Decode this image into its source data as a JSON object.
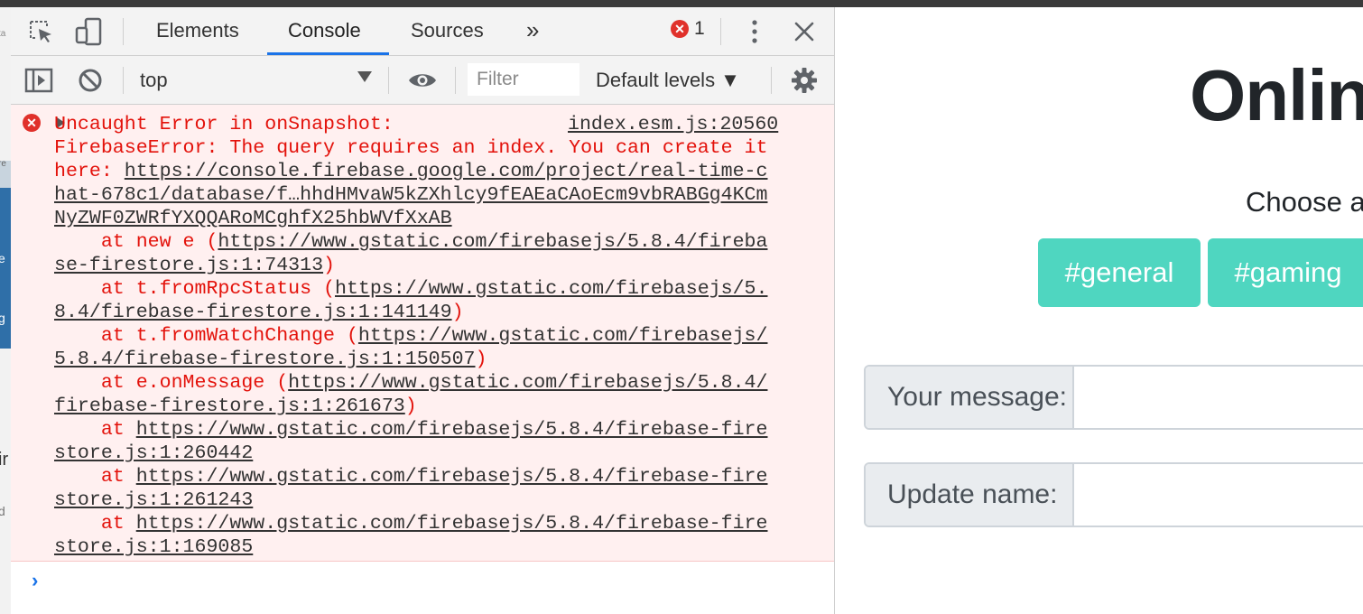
{
  "devtools": {
    "tabs": {
      "elements": "Elements",
      "console": "Console",
      "sources": "Sources",
      "more": "»"
    },
    "error_count": "1",
    "toolbar": {
      "context": "top",
      "filter_placeholder": "Filter",
      "levels": "Default levels ▼"
    },
    "console_error": {
      "source": "index.esm.js:20560",
      "lines": [
        {
          "t": "Uncaught Error in onSnapshot:"
        },
        {
          "t": "FirebaseError: The query requires an index. You can create it"
        },
        {
          "t": "here: ",
          "link": "https://console.firebase.google.com/project/real-time-c"
        },
        {
          "link": "hat-678c1/database/f…hhdHMvaW5kZXhlcy9fEAEaCAoEcm9vbRABGg4KCm"
        },
        {
          "link": "NyZWF0ZWRfYXQQARoMCghfX25hbWVfXxAB"
        },
        {
          "t": "    at new e (",
          "link": "https://www.gstatic.com/firebasejs/5.8.4/fireba"
        },
        {
          "link": "se-firestore.js:1:74313",
          "after": ")"
        },
        {
          "t": "    at t.fromRpcStatus (",
          "link": "https://www.gstatic.com/firebasejs/5."
        },
        {
          "link": "8.4/firebase-firestore.js:1:141149",
          "after": ")"
        },
        {
          "t": "    at t.fromWatchChange (",
          "link": "https://www.gstatic.com/firebasejs/"
        },
        {
          "link": "5.8.4/firebase-firestore.js:1:150507",
          "after": ")"
        },
        {
          "t": "    at e.onMessage (",
          "link": "https://www.gstatic.com/firebasejs/5.8.4/"
        },
        {
          "link": "firebase-firestore.js:1:261673",
          "after": ")"
        },
        {
          "t": "    at ",
          "link": "https://www.gstatic.com/firebasejs/5.8.4/firebase-fire"
        },
        {
          "link": "store.js:1:260442"
        },
        {
          "t": "    at ",
          "link": "https://www.gstatic.com/firebasejs/5.8.4/firebase-fire"
        },
        {
          "link": "store.js:1:261243"
        },
        {
          "t": "    at ",
          "link": "https://www.gstatic.com/firebasejs/5.8.4/firebase-fire"
        },
        {
          "link": "store.js:1:169085"
        }
      ]
    },
    "prompt": "›",
    "icons": [
      "inspect-icon",
      "device-toggle-icon",
      "more-tabs-icon",
      "kebab-menu-icon",
      "close-icon",
      "sidebar-toggle-icon",
      "clear-console-icon",
      "eye-icon",
      "settings-gear-icon"
    ],
    "colors": {
      "error_red": "#e3120b",
      "error_bg": "#fff0f0",
      "accent_blue": "#1a73e8"
    }
  },
  "page": {
    "title": "Online",
    "subtitle": "Choose a",
    "channels": [
      "#general",
      "#gaming"
    ],
    "fields": {
      "message_label": "Your message:",
      "name_label": "Update name:"
    },
    "colors": {
      "channel_button": "#4fd6c0"
    }
  },
  "left_peek": {
    "fragments": [
      "e",
      "g",
      "ir",
      "d",
      "re",
      "ta"
    ]
  }
}
